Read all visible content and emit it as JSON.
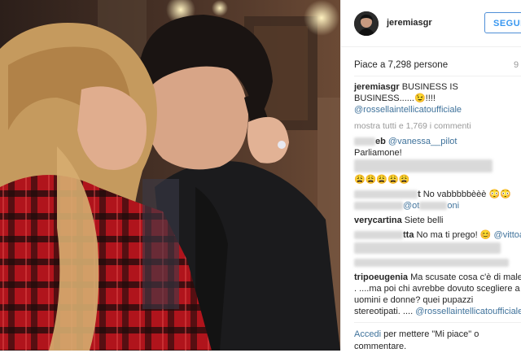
{
  "post": {
    "username": "jeremiasgr",
    "follow_label": "SEGUI",
    "likes_text": "Piace a 7,298 persone",
    "time_ago": "9",
    "caption_user": "jeremiasgr",
    "caption_line1": "BUSINESS IS",
    "caption_line2": "BUSINESS......😉!!!!",
    "caption_mention": "@rossellaintellicatoufficiale",
    "show_all": "mostra tutti e 1,769 i commenti"
  },
  "comments": [
    {
      "user_tail": "eb",
      "mention": "@vanessa__pilot",
      "text": "Parliamone!"
    },
    {
      "user": "",
      "text": "😩😩😩😩😩"
    },
    {
      "user_tail": "t",
      "text": "No vabbbbbèèè 😳😳",
      "mention_tail": "@ot",
      "mention_end": "oni"
    },
    {
      "user": "verycartina",
      "text": "Siete belli"
    },
    {
      "user_tail": "tta",
      "text": "No ma ti prego! 😊",
      "mention": "@vittoally"
    },
    {
      "user_tail": "tripoeugenia",
      "text_l1": "Ma scusate cosa c'è di male",
      "text_l2": ". ....ma poi chi avrebbe dovuto scegliere a",
      "text_l3": "uomini e donne? quei pupazzi",
      "text_l4": "stereotipati. ....",
      "mention": "@rossellaintellicatoufficiale"
    }
  ],
  "footer": {
    "login_link": "Accedi",
    "rest": "per mettere \"Mi piace\" o",
    "line2": "commentare."
  },
  "colors": {
    "follow_border": "#4f8fd7",
    "mention": "#3f729b",
    "muted": "#999999"
  }
}
